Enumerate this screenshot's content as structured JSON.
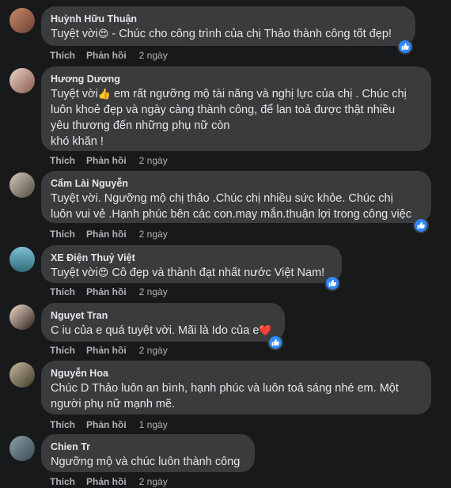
{
  "actions": {
    "like": "Thích",
    "reply": "Phản hồi"
  },
  "colors": {
    "background": "#18191a",
    "bubble": "#3a3b3c",
    "like_blue": "#2e89ff",
    "secondary_text": "#b0b3b8"
  },
  "comments": [
    {
      "author": "Huỳnh Hữu Thuận",
      "text_before": "Tuyệt vời",
      "emoji": "😍",
      "text_after": " - Chúc cho công trình của chị Thảo thành công tốt đẹp!",
      "time": "2 ngày",
      "has_like": true
    },
    {
      "author": "Hương Dương",
      "text_before": "Tuyệt vời",
      "emoji": "👍",
      "text_after": " em rất ngưỡng mộ tài năng và nghị lực của chị . Chúc chị\nluôn khoẻ đẹp và ngày càng thành công, để lan toả được thật nhiều\nyêu thương đến những phụ nữ còn\nkhó khăn !",
      "time": "2 ngày",
      "has_like": false
    },
    {
      "author": "Cẩm Lài Nguyễn",
      "text_before": "Tuyệt vời. Ngưỡng mộ chị thảo .Chúc chị nhiều sức khỏe. Chúc chị\nluôn vui vẻ .Hạnh phúc bên các con.may mắn.thuận lợi trong công việc",
      "emoji": "",
      "text_after": "",
      "time": "2 ngày",
      "has_like": true
    },
    {
      "author": "XE Điện Thuỷ Việt",
      "text_before": "Tuyệt vời",
      "emoji": "😍",
      "text_after": " Cô đẹp và thành đạt nhất nước Việt Nam!",
      "time": "2 ngày",
      "has_like": true
    },
    {
      "author": "Nguyet Tran",
      "text_before": "C iu của e quá tuyệt vời. Mãi là Ido của e",
      "emoji": "❤️",
      "text_after": "",
      "time": "2 ngày",
      "has_like": true
    },
    {
      "author": "Nguyễn Hoa",
      "text_before": "Chúc D Thảo luôn an bình, hạnh phúc và luôn toả sáng nhé em. Một\nngười phụ nữ mạnh mẽ.",
      "emoji": "",
      "text_after": "",
      "time": "1 ngày",
      "has_like": false
    },
    {
      "author": "Chien Tr",
      "text_before": "Ngưỡng mộ và chúc luôn thành công",
      "emoji": "",
      "text_after": "",
      "time": "2 ngày",
      "has_like": false
    }
  ]
}
